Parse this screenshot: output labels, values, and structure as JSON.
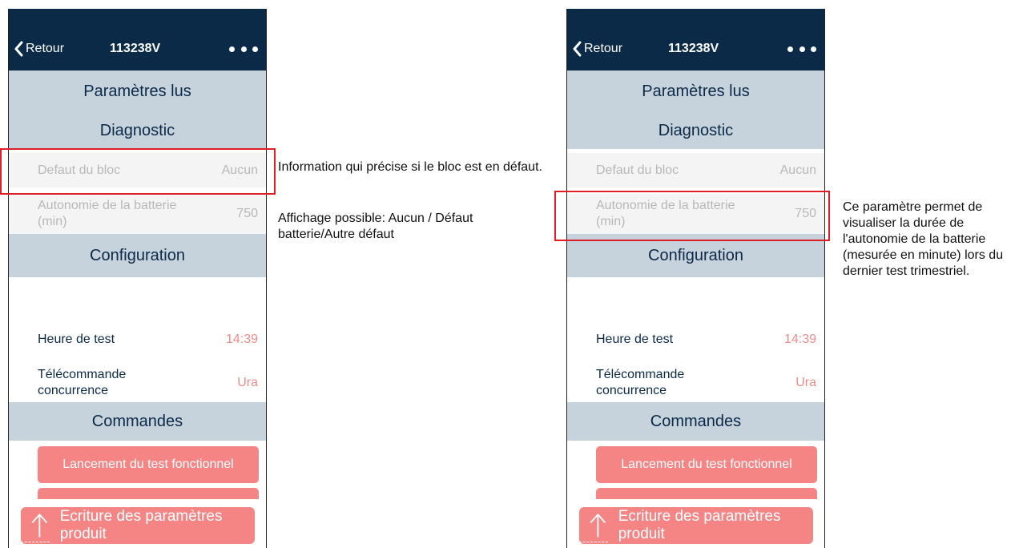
{
  "screens": [
    {
      "navbar": {
        "back_label": "Retour",
        "title": "113238V"
      },
      "sections": {
        "parametres": "Paramètres lus",
        "diagnostic": "Diagnostic",
        "configuration": "Configuration",
        "commandes": "Commandes"
      },
      "diagnostic_rows": [
        {
          "label": "Defaut du bloc",
          "value": "Aucun"
        },
        {
          "label": "Autonomie de la batterie (min)",
          "value": "750"
        }
      ],
      "config_rows": [
        {
          "label": "Heure de test",
          "value": "14:39"
        },
        {
          "label": "Télécommande concurrence",
          "value": "Ura"
        }
      ],
      "commands": {
        "test_button": "Lancement du test fonctionnel"
      },
      "write_button": "Ecriture des paramètres produit"
    },
    {
      "navbar": {
        "back_label": "Retour",
        "title": "113238V"
      },
      "sections": {
        "parametres": "Paramètres lus",
        "diagnostic": "Diagnostic",
        "configuration": "Configuration",
        "commandes": "Commandes"
      },
      "diagnostic_rows": [
        {
          "label": "Defaut du bloc",
          "value": "Aucun"
        },
        {
          "label": "Autonomie de la batterie (min)",
          "value": "750"
        }
      ],
      "config_rows": [
        {
          "label": "Heure de test",
          "value": "14:39"
        },
        {
          "label": "Télécommande concurrence",
          "value": "Ura"
        }
      ],
      "commands": {
        "test_button": "Lancement du test fonctionnel"
      },
      "write_button": "Ecriture des paramètres produit"
    }
  ],
  "annotations": {
    "left_line1": "Information qui précise si le bloc est en défaut.",
    "left_line2": "Affichage possible: Aucun / Défaut batterie/Autre défaut",
    "right": "Ce paramètre permet de visualiser la durée de l'autonomie de la batterie (mesurée en minute) lors du dernier test trimestriel."
  },
  "colors": {
    "navbar": "#0b2a48",
    "section_bg": "#c6d2dc",
    "accent_button": "#f58585",
    "value_red": "#f28b8b",
    "highlight_box": "#e01e25"
  },
  "icons": {
    "back": "chevron-left-icon",
    "more": "more-dots-icon",
    "upload": "arrow-up-icon"
  }
}
